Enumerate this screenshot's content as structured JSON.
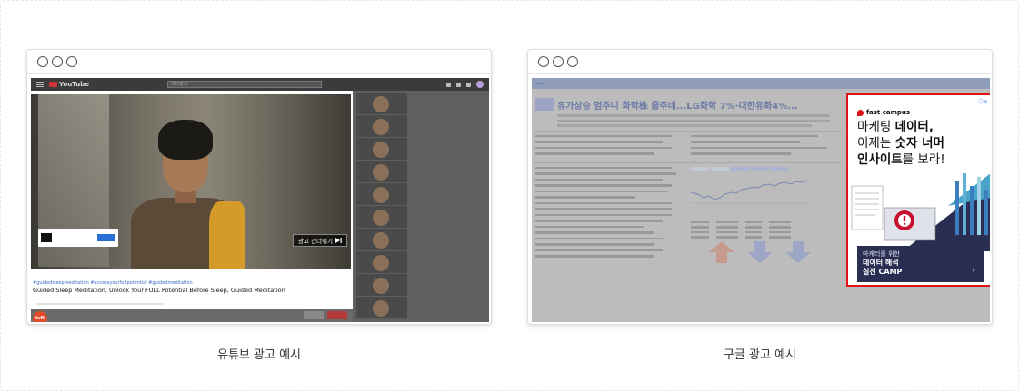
{
  "captions": {
    "left": "유튜브 광고 예시",
    "right": "구글 광고 예시"
  },
  "youtube": {
    "logo_text": "YouTube",
    "search_placeholder": "바이알고",
    "skip_ad_label": "광고 건너뛰기",
    "skip_icon": "skip-next-icon",
    "hashtags": "#guidedsleepmeditation #accessyourfullpotential #guidedmeditation",
    "video_title": "Guided Sleep Meditation, Unlock Your FULL Potential Before Sleep, Guided Meditation",
    "channel_badge": "tvN",
    "progress_fraction": 0.06,
    "accent_colors": {
      "progress": "#f2d23c",
      "logo": "#cc3333",
      "subscribe": "#b23a3a"
    }
  },
  "google": {
    "headline": "유가상승 멈추니 화학株 줍주네...LG화학 7%·대한유화4%...",
    "ad": {
      "brand": "fast campus",
      "close_icon": "ad-choices-close-icon",
      "line1_plain": "마케팅 ",
      "line1_bold": "데이터,",
      "line2_plain": "이제는 ",
      "line2_bold": "숫자 너머",
      "line3_bold": "인사이트",
      "line3_plain": "를 보라!",
      "cta_line1": "마케터를 위한",
      "cta_line2": "데이터 해석",
      "cta_line3": "실전 CAMP",
      "cta_arrow": "›",
      "border_color": "#e1131a",
      "cta_color": "#2a2e52"
    }
  }
}
